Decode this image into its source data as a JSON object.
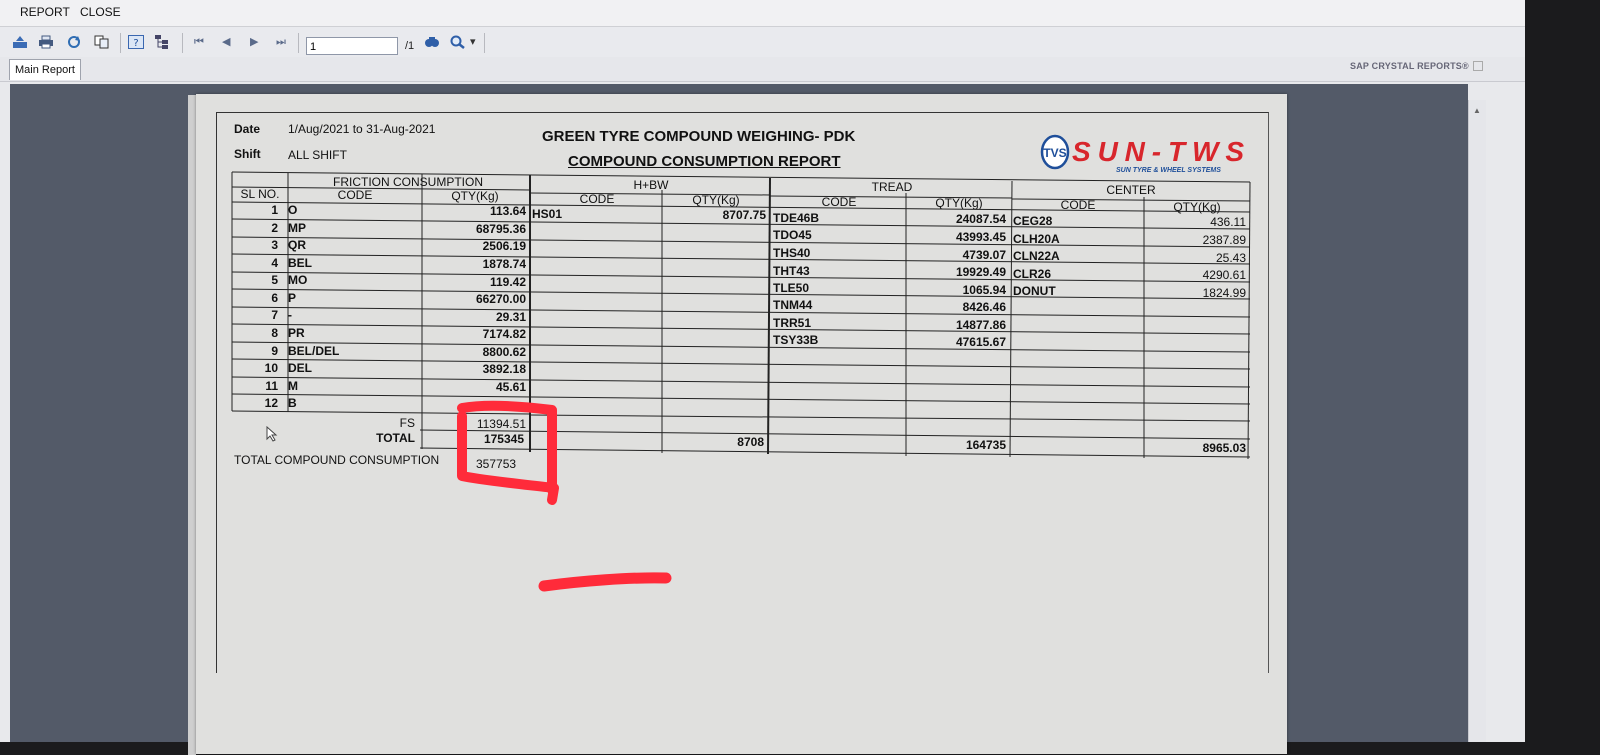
{
  "menu": {
    "report": "REPORT",
    "close": "CLOSE"
  },
  "toolbar": {
    "page_value": "1",
    "page_total": "/1",
    "icons": [
      "export-icon",
      "print-icon",
      "refresh-icon",
      "copy-icon",
      "help-icon",
      "group-tree-icon",
      "first-page-icon",
      "prev-page-icon",
      "next-page-icon",
      "last-page-icon",
      "search-icon",
      "zoom-icon"
    ]
  },
  "tabs": {
    "main_report": "Main Report"
  },
  "brand": "SAP CRYSTAL REPORTS®",
  "report": {
    "date_label": "Date",
    "date_value": "1/Aug/2021 to 31-Aug-2021",
    "shift_label": "Shift",
    "shift_value": "ALL SHIFT",
    "title": "GREEN TYRE COMPOUND  WEIGHING-  PDK",
    "subtitle": "COMPOUND CONSUMPTION  REPORT",
    "logo": {
      "badge": "TVS",
      "name": "SUN-TWS",
      "tagline": "SUN TYRE & WHEEL SYSTEMS",
      "color": "#d8262c"
    },
    "groups": {
      "friction": "FRICTION CONSUMPTION",
      "hbw": "H+BW",
      "tread": "TREAD",
      "center": "CENTER"
    },
    "col": {
      "sl_no": "SL NO.",
      "code": "CODE",
      "qty": "QTY(Kg)"
    },
    "friction_rows": [
      {
        "sl": "1",
        "code": "O",
        "qty": "113.64"
      },
      {
        "sl": "2",
        "code": "MP",
        "qty": "68795.36"
      },
      {
        "sl": "3",
        "code": "QR",
        "qty": "2506.19"
      },
      {
        "sl": "4",
        "code": "BEL",
        "qty": "1878.74"
      },
      {
        "sl": "5",
        "code": "MO",
        "qty": "119.42"
      },
      {
        "sl": "6",
        "code": "P",
        "qty": "66270.00"
      },
      {
        "sl": "7",
        "code": "-",
        "qty": "29.31"
      },
      {
        "sl": "8",
        "code": "PR",
        "qty": "7174.82"
      },
      {
        "sl": "9",
        "code": "BEL/DEL",
        "qty": "8800.62"
      },
      {
        "sl": "10",
        "code": "DEL",
        "qty": "3892.18"
      },
      {
        "sl": "11",
        "code": "M",
        "qty": "45.61"
      },
      {
        "sl": "12",
        "code": "B",
        "qty": ""
      }
    ],
    "hbw_rows": [
      {
        "code": "HS01",
        "qty": "8707.75"
      }
    ],
    "tread_rows": [
      {
        "code": "TDE46B",
        "qty": "24087.54"
      },
      {
        "code": "TDO45",
        "qty": "43993.45"
      },
      {
        "code": "THS40",
        "qty": "4739.07"
      },
      {
        "code": "THT43",
        "qty": "19929.49"
      },
      {
        "code": "TLE50",
        "qty": "1065.94"
      },
      {
        "code": "TNM44",
        "qty": "8426.46"
      },
      {
        "code": "TRR51",
        "qty": "14877.86"
      },
      {
        "code": "TSY33B",
        "qty": "47615.67"
      }
    ],
    "center_rows": [
      {
        "code": "CEG28",
        "qty": "436.11"
      },
      {
        "code": "CLH20A",
        "qty": "2387.89"
      },
      {
        "code": "CLN22A",
        "qty": "25.43"
      },
      {
        "code": "CLR26",
        "qty": "4290.61"
      },
      {
        "code": "DONUT",
        "qty": "1824.99"
      }
    ],
    "fs_label": "FS",
    "fs_value": "11394.51",
    "total_label": "TOTAL",
    "friction_total": "175345",
    "hbw_total": "8708",
    "tread_total": "164735",
    "center_total": "8965.03",
    "grand_total_label": "TOTAL COMPOUND CONSUMPTION",
    "grand_total_value": "357753"
  },
  "annotation_color": "#ff2b3a"
}
